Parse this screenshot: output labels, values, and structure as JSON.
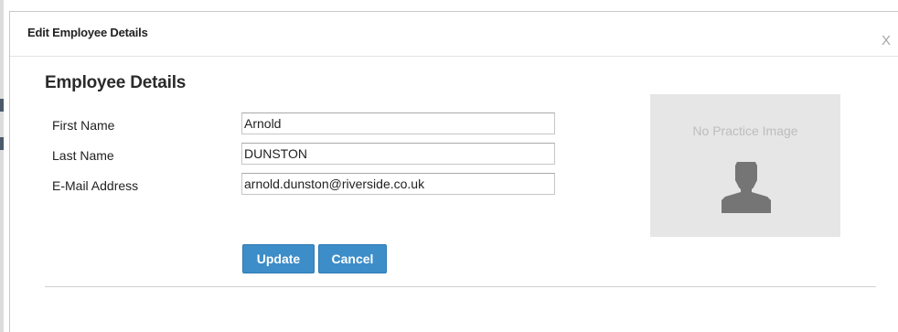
{
  "dialog": {
    "title": "Edit Employee Details",
    "close_label": "X"
  },
  "section": {
    "title": "Employee Details"
  },
  "fields": [
    {
      "label": "First Name",
      "value": "Arnold"
    },
    {
      "label": "Last Name",
      "value": "DUNSTON"
    },
    {
      "label": "E-Mail Address",
      "value": "arnold.dunston@riverside.co.uk"
    }
  ],
  "actions": {
    "update_label": "Update",
    "cancel_label": "Cancel"
  },
  "photo": {
    "placeholder_text": "No Practice Image",
    "icon": "person-silhouette-icon"
  },
  "colors": {
    "button_primary": "#3d8dc9",
    "photo_background": "#e6e6e6",
    "avatar_silhouette": "#757575"
  }
}
